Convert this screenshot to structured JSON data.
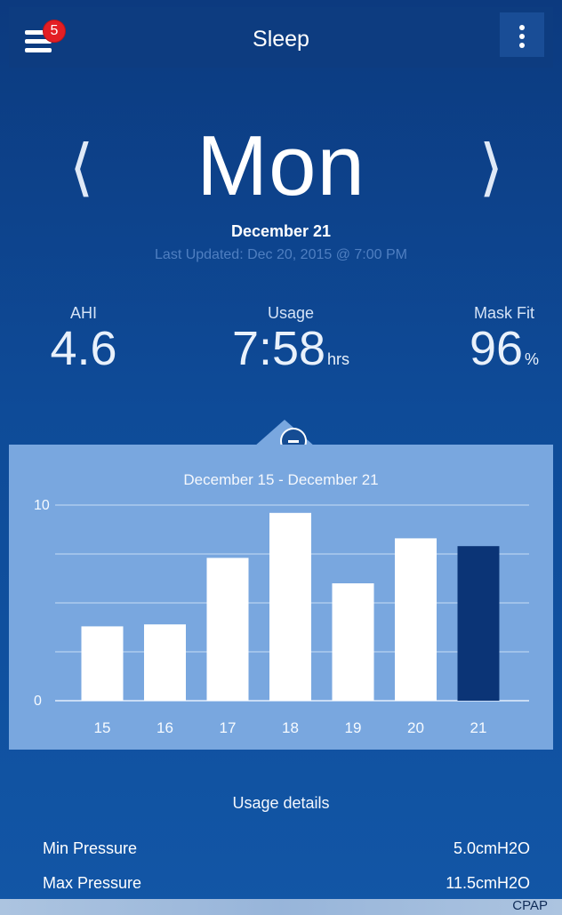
{
  "header": {
    "title": "Sleep",
    "badge_count": "5",
    "menu_icon": "hamburger-icon",
    "more_icon": "more-vertical-icon"
  },
  "navigation": {
    "day": "Mon",
    "date": "December 21",
    "last_updated": "Last Updated: Dec 20, 2015 @ 7:00 PM",
    "previous_icon": "chevron-left-icon",
    "next_icon": "chevron-right-icon"
  },
  "stats": {
    "ahi": {
      "label": "AHI",
      "value": "4.6"
    },
    "usage": {
      "label": "Usage",
      "value": "7:58",
      "unit": "hrs"
    },
    "mask_fit": {
      "label": "Mask Fit",
      "value": "96",
      "unit": "%"
    }
  },
  "chart_data": {
    "type": "bar",
    "title": "December 15 - December 21",
    "categories": [
      "15",
      "16",
      "17",
      "18",
      "19",
      "20",
      "21"
    ],
    "values": [
      3.8,
      3.9,
      7.3,
      9.6,
      6.0,
      8.3,
      7.9
    ],
    "ylim": [
      0,
      10
    ],
    "y_tick_labels": [
      "0",
      "10"
    ],
    "grid": true,
    "highlighted_category": "21",
    "colors": {
      "bar": "#ffffff",
      "highlight": "#0b3476",
      "background": "#79a7df"
    }
  },
  "details": {
    "title": "Usage details",
    "rows": [
      {
        "name": "Min Pressure",
        "value": "5.0cmH2O"
      },
      {
        "name": "Max Pressure",
        "value": "11.5cmH2O"
      }
    ],
    "partially_visible_text": "CPAP"
  }
}
